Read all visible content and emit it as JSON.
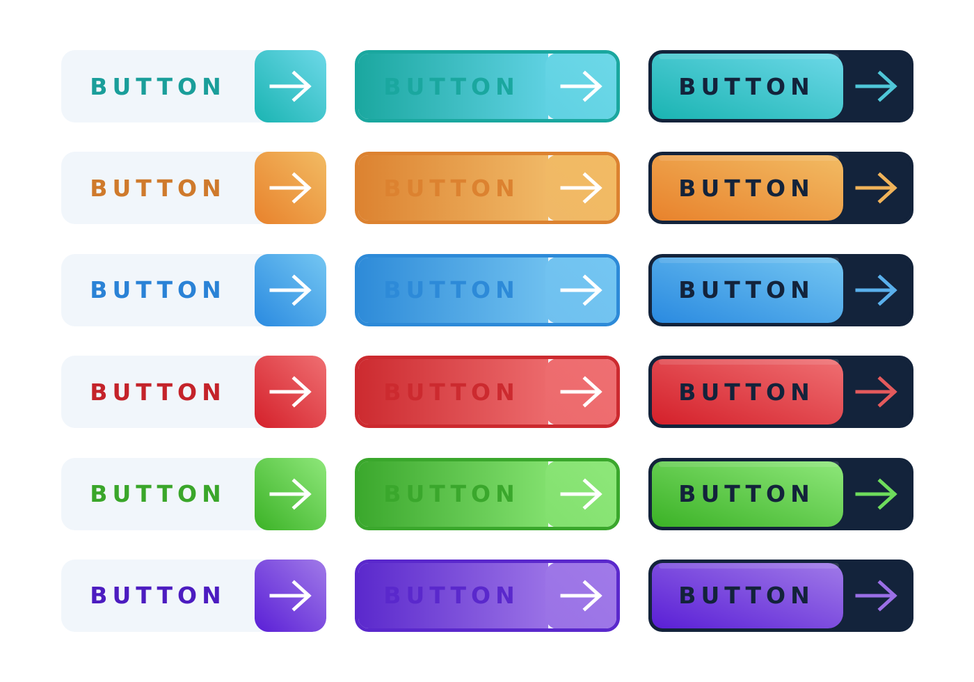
{
  "buttons": {
    "label": "BUTTON",
    "icon": "arrow-right-icon",
    "styles": [
      "soft",
      "outlined",
      "dark"
    ],
    "rows": [
      {
        "name": "teal",
        "text": "#1a9e9a",
        "c1": "#1ab4b2",
        "c2": "#6dd8e8",
        "outline1": "#1aa79f",
        "outline2": "#5fd1e2",
        "dark_arrow": "#4fc6d8"
      },
      {
        "name": "orange",
        "text": "#cf7a2c",
        "c1": "#e8822c",
        "c2": "#f2bb63",
        "outline1": "#dc8230",
        "outline2": "#f0b866",
        "dark_arrow": "#f0b35a"
      },
      {
        "name": "blue",
        "text": "#2a82d6",
        "c1": "#2a8ae0",
        "c2": "#74c6f2",
        "outline1": "#2d8ad8",
        "outline2": "#6fc0ef",
        "dark_arrow": "#5ab0ec"
      },
      {
        "name": "red",
        "text": "#c4232a",
        "c1": "#d4202a",
        "c2": "#ef6f72",
        "outline1": "#cc2a2f",
        "outline2": "#ec6a6c",
        "dark_arrow": "#e45a5c"
      },
      {
        "name": "green",
        "text": "#3aa62a",
        "c1": "#3bb226",
        "c2": "#8ee77a",
        "outline1": "#3aa72c",
        "outline2": "#82e06e",
        "dark_arrow": "#6edc5c"
      },
      {
        "name": "purple",
        "text": "#4c1cc0",
        "c1": "#5a1fd6",
        "c2": "#a07ae8",
        "outline1": "#5a28cc",
        "outline2": "#9a72e6",
        "dark_arrow": "#9a6fe6"
      }
    ]
  }
}
